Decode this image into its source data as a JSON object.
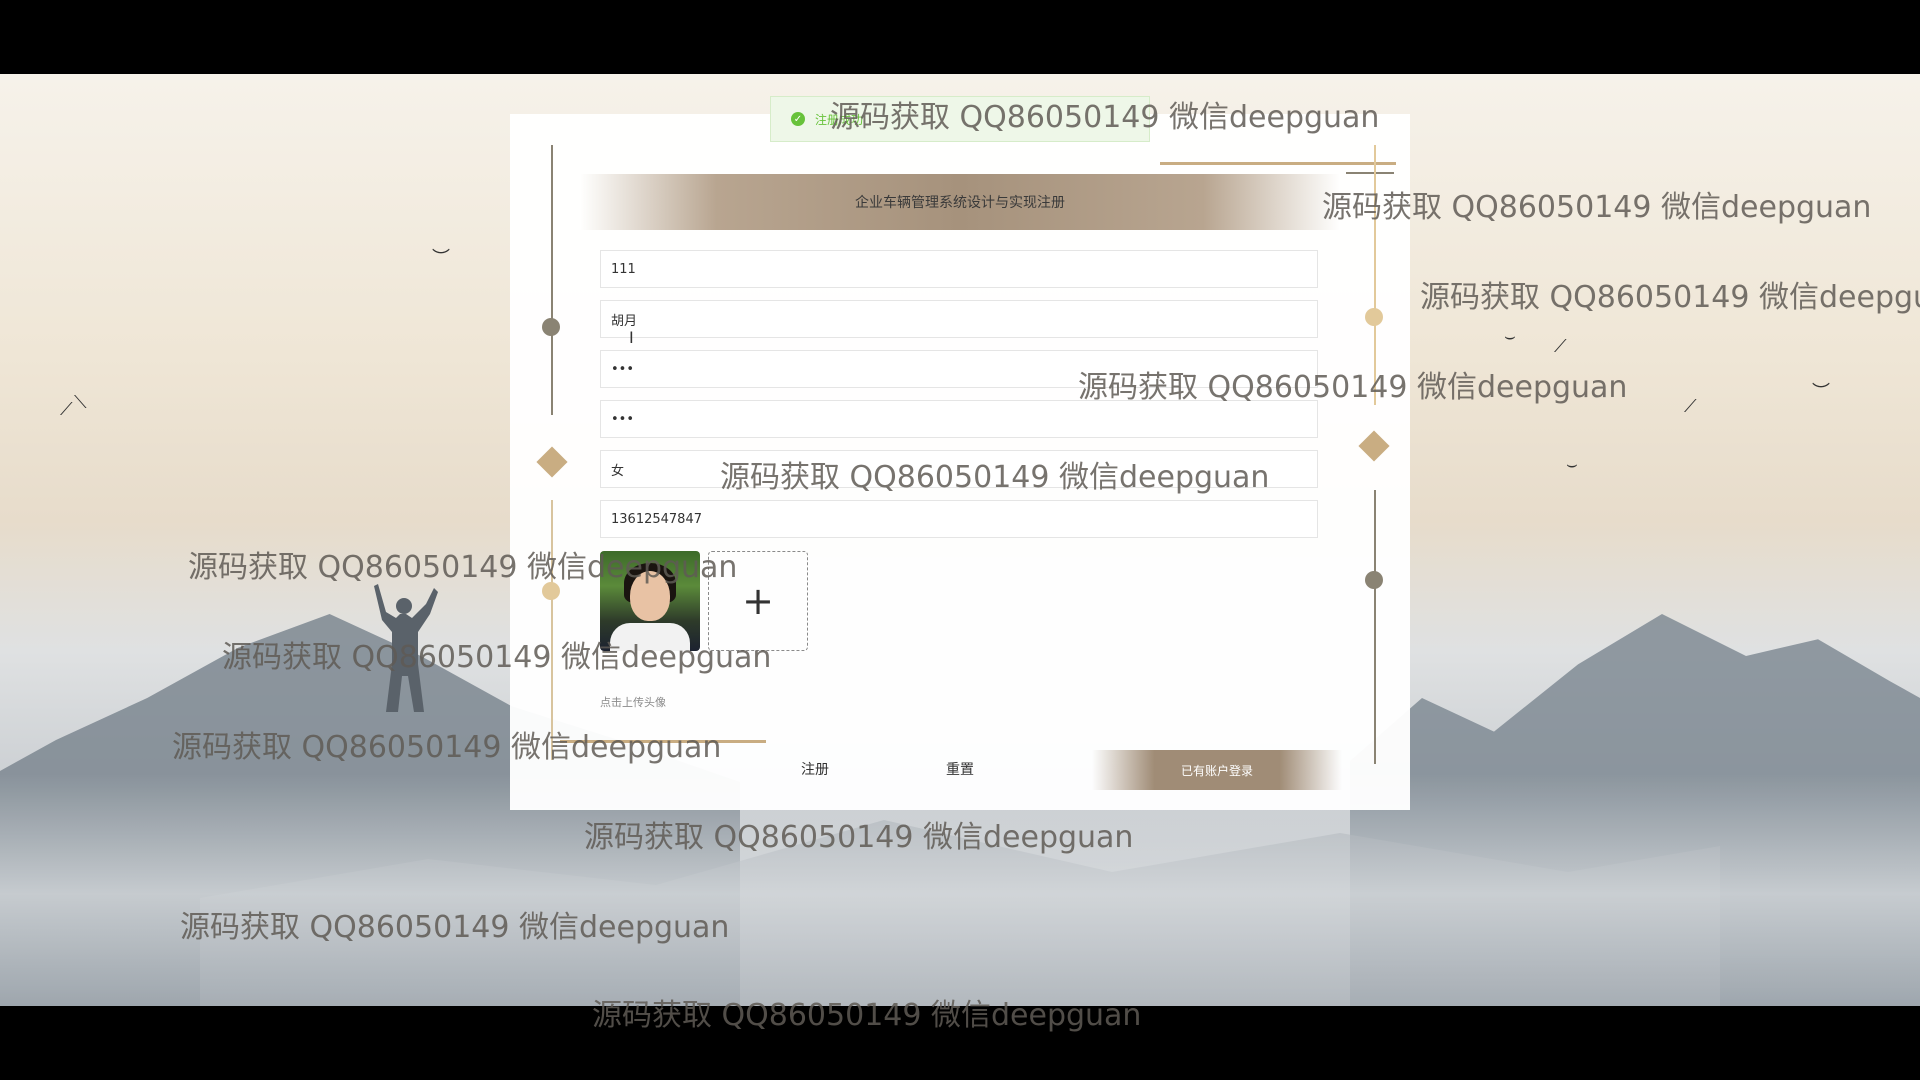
{
  "toast": {
    "icon": "check-circle-icon",
    "text": "注册成功"
  },
  "form": {
    "title": "企业车辆管理系统设计与实现注册",
    "fields": [
      {
        "name": "account",
        "value": "111"
      },
      {
        "name": "name",
        "value": "胡月"
      },
      {
        "name": "password",
        "value": "•••"
      },
      {
        "name": "confirm_password",
        "value": "•••"
      },
      {
        "name": "gender",
        "value": "女"
      },
      {
        "name": "phone",
        "value": "13612547847"
      }
    ],
    "uploader_symbol": "+",
    "upload_hint": "点击上传头像",
    "buttons": {
      "register": "注册",
      "reset": "重置",
      "login": "已有账户登录"
    }
  },
  "watermark": "源码获取 QQ86050149 微信deepguan",
  "colors": {
    "accent": "#a08c76",
    "gold": "#c9ad82",
    "success": "#67c23a"
  }
}
